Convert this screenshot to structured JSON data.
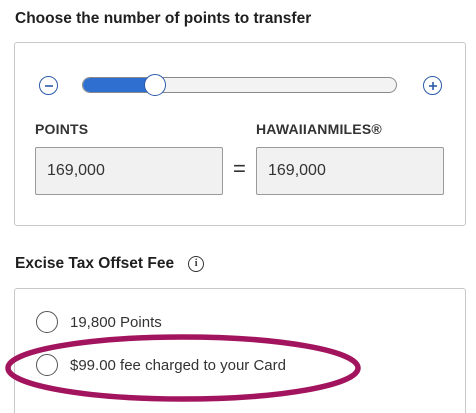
{
  "transfer": {
    "title": "Choose the number of points to transfer",
    "slider": {
      "level": 0.232
    },
    "points_label": "POINTS",
    "points_value": "169,000",
    "equals": "=",
    "miles_label": "HAWAIIANMILES®",
    "miles_value": "169,000",
    "decrease_icon": "minus-circle-icon",
    "increase_icon": "plus-circle-icon"
  },
  "fee": {
    "title": "Excise Tax Offset Fee",
    "info_icon": "info-icon",
    "info_glyph": "i",
    "options": [
      {
        "label": "19,800 Points",
        "selected": false
      },
      {
        "label": "$99.00 fee charged to your Card",
        "selected": false
      }
    ],
    "annotation_color": "#a3145e"
  },
  "colors": {
    "accent": "#2c5aa8",
    "slider_fill": "#2f6fd0",
    "input_bg": "#f1f1f1"
  }
}
